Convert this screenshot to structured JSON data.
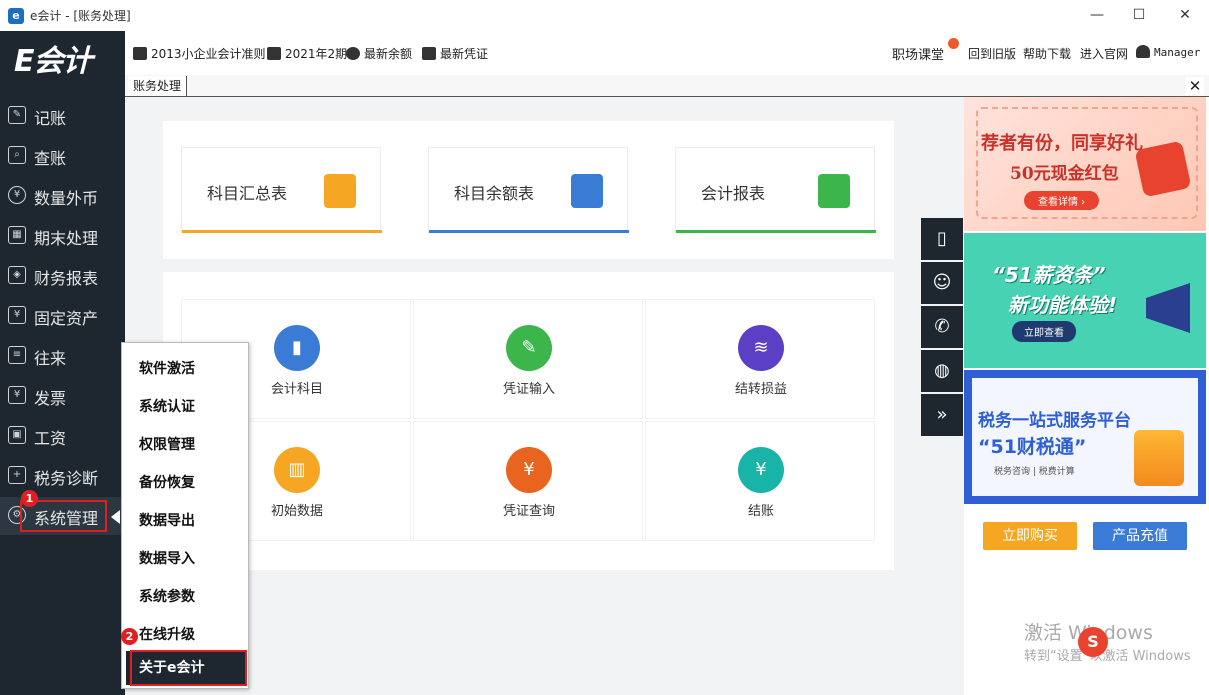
{
  "window": {
    "title": "e会计 - [账务处理]",
    "minimize": "—",
    "maximize": "☐",
    "close": "✕"
  },
  "app": {
    "logo": "E会计"
  },
  "toolbar": {
    "standard": "2013小企业会计准则",
    "period": "2021年2期",
    "balance": "最新余额",
    "voucher": "最新凭证",
    "career": "职场课堂",
    "old_version": "回到旧版",
    "help": "帮助下载",
    "site": "进入官网",
    "user": "Manager"
  },
  "tabs": {
    "active": "账务处理",
    "close": "✕"
  },
  "sidebar": {
    "items": [
      "记账",
      "查账",
      "数量外币",
      "期末处理",
      "财务报表",
      "固定资产",
      "往来",
      "发票",
      "工资",
      "税务诊断",
      "系统管理"
    ]
  },
  "quick": [
    "科目汇总表",
    "科目余额表",
    "会计报表"
  ],
  "functions": [
    "会计科目",
    "凭证输入",
    "结转损益",
    "初始数据",
    "凭证查询",
    "结账"
  ],
  "menu": {
    "items": [
      "软件激活",
      "系统认证",
      "权限管理",
      "备份恢复",
      "数据导出",
      "数据导入",
      "系统参数",
      "在线升级",
      "关于e会计"
    ]
  },
  "badges": [
    "1",
    "2"
  ],
  "banners": {
    "b1": {
      "line1": "荐者有份，同享好礼",
      "line2": "50元现金红包",
      "button": "查看详情 ›"
    },
    "b2": {
      "line1": "“51薪资条”",
      "line2": "新功能体验!",
      "button": "立即查看"
    },
    "b3": {
      "line1": "税务一站式服务平台",
      "line2": "“51财税通”",
      "tags": "税务咨询 | 税费计算"
    }
  },
  "actions": {
    "buy": "立即购买",
    "recharge": "产品充值"
  },
  "watermark": {
    "line1": "激活 Windows",
    "line2": "转到“设置”以激活 Windows"
  },
  "colors": {
    "sidebar": "#1e2730",
    "orange": "#f5a623",
    "blue": "#3a7bd5",
    "green": "#3cb54a",
    "highlight": "#e02020"
  }
}
